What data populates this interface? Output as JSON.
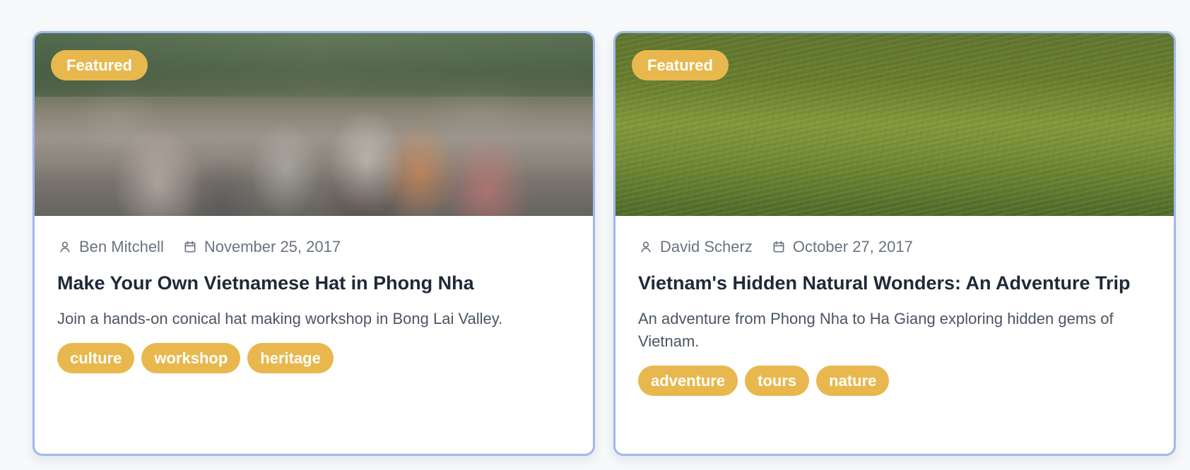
{
  "cards": [
    {
      "featured_label": "Featured",
      "author": "Ben Mitchell",
      "date": "November 25, 2017",
      "title": "Make Your Own Vietnamese Hat in Phong Nha",
      "description": "Join a hands-on conical hat making workshop in Bong Lai Valley.",
      "tags": [
        "culture",
        "workshop",
        "heritage"
      ]
    },
    {
      "featured_label": "Featured",
      "author": "David Scherz",
      "date": "October 27, 2017",
      "title": "Vietnam's Hidden Natural Wonders: An Adventure Trip",
      "description": "An adventure from Phong Nha to Ha Giang exploring hidden gems of Vietnam.",
      "tags": [
        "adventure",
        "tours",
        "nature"
      ]
    }
  ],
  "icons": {
    "author": "user-icon",
    "date": "calendar-icon"
  },
  "colors": {
    "background": "#f7f9fb",
    "card_border": "#9fb8ef",
    "badge": "#e8b84e",
    "badge_text": "#ffffff",
    "title_text": "#1f2937",
    "meta_text": "#6b7280",
    "description_text": "#4b5563"
  }
}
